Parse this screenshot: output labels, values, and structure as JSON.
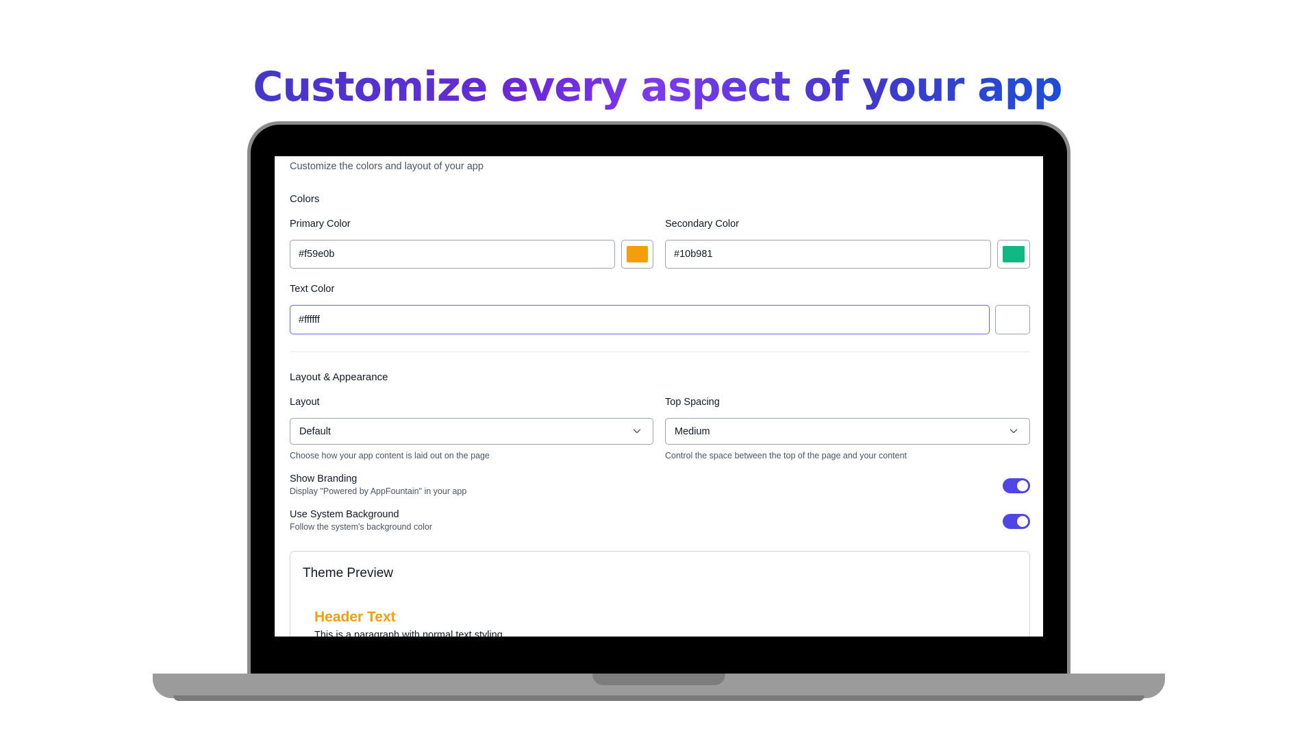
{
  "headline": "Customize every aspect of your app",
  "screen": {
    "subtitle": "Customize the colors and layout of your app",
    "colors_section": {
      "title": "Colors",
      "primary": {
        "label": "Primary Color",
        "value": "#f59e0b",
        "swatch": "#f59e0b"
      },
      "secondary": {
        "label": "Secondary Color",
        "value": "#10b981",
        "swatch": "#10b981"
      },
      "text": {
        "label": "Text Color",
        "value": "#ffffff",
        "swatch": "#ffffff"
      }
    },
    "layout_section": {
      "title": "Layout & Appearance",
      "layout": {
        "label": "Layout",
        "value": "Default",
        "help": "Choose how your app content is laid out on the page"
      },
      "top_spacing": {
        "label": "Top Spacing",
        "value": "Medium",
        "help": "Control the space between the top of the page and your content"
      },
      "show_branding": {
        "label": "Show Branding",
        "description": "Display \"Powered by AppFountain\" in your app",
        "on": true
      },
      "system_background": {
        "label": "Use System Background",
        "description": "Follow the system's background color",
        "on": true
      }
    },
    "preview": {
      "title": "Theme Preview",
      "header_text": "Header Text",
      "header_color": "#f59e0b",
      "paragraph": "This is a paragraph with normal text styling."
    }
  },
  "colors": {
    "accent": "#4f46e5",
    "headline_gradient": [
      "#4338ca",
      "#7c3aed",
      "#1d4ed8"
    ]
  },
  "icons": {
    "select_chevron": "chevron-down-icon"
  }
}
